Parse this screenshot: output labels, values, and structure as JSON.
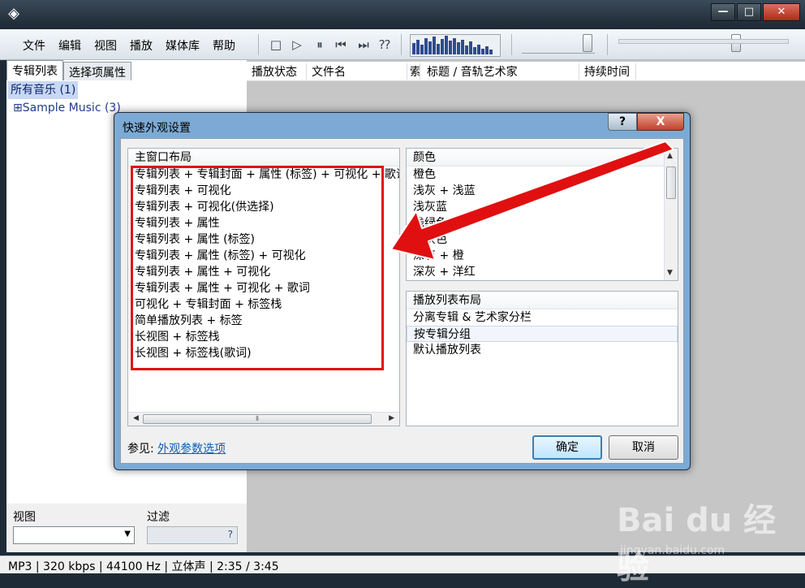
{
  "menu": [
    "文件",
    "编辑",
    "视图",
    "播放",
    "媒体库",
    "帮助"
  ],
  "left": {
    "tabs": [
      "专辑列表",
      "选择项属性"
    ],
    "tree": [
      "所有音乐 (1)",
      "Sample Music (3)"
    ],
    "view_label": "视图",
    "filter_label": "过滤",
    "filter_help": "?"
  },
  "columns": [
    "播放状态",
    "文件名",
    "索",
    "标题 / 音轨艺术家",
    "持续时间"
  ],
  "status": "MP3 | 320 kbps | 44100 Hz | 立体声 | 2:35 / 3:45",
  "dialog": {
    "title": "快速外观设置",
    "help": "?",
    "close": "X",
    "layout_header": "主窗口布局",
    "layouts": [
      "专辑列表 + 专辑封面 + 属性 (标签) + 可视化 + 歌词",
      "专辑列表 + 可视化",
      "专辑列表 + 可视化(供选择)",
      "专辑列表 + 属性",
      "专辑列表 + 属性 (标签)",
      "专辑列表 + 属性 (标签) + 可视化",
      "专辑列表 + 属性 + 可视化",
      "专辑列表 + 属性 + 可视化 + 歌词",
      "可视化 + 专辑封面 + 标签栈",
      "简单播放列表 + 标签",
      "长视图 + 标签栈",
      "长视图 + 标签栈(歌词)"
    ],
    "color_header": "颜色",
    "colors": [
      "橙色",
      "浅灰 + 浅蓝",
      "浅灰蓝",
      "浅绿色",
      "深灰色",
      "深灰 + 橙",
      "深灰 + 洋红"
    ],
    "playlist_header": "播放列表布局",
    "playlists": [
      "分离专辑 & 艺术家分栏",
      "按专辑分组",
      "默认播放列表"
    ],
    "see_also": "参见:",
    "see_also_link": "外观参数选项",
    "ok": "确定",
    "cancel": "取消"
  },
  "watermark": "Bai du 经验",
  "watermark_sub": "jingyan.baidu.com",
  "colors": {
    "highlight": "#e01010",
    "arrow": "#e01010",
    "selection": "#c8d8f4"
  }
}
